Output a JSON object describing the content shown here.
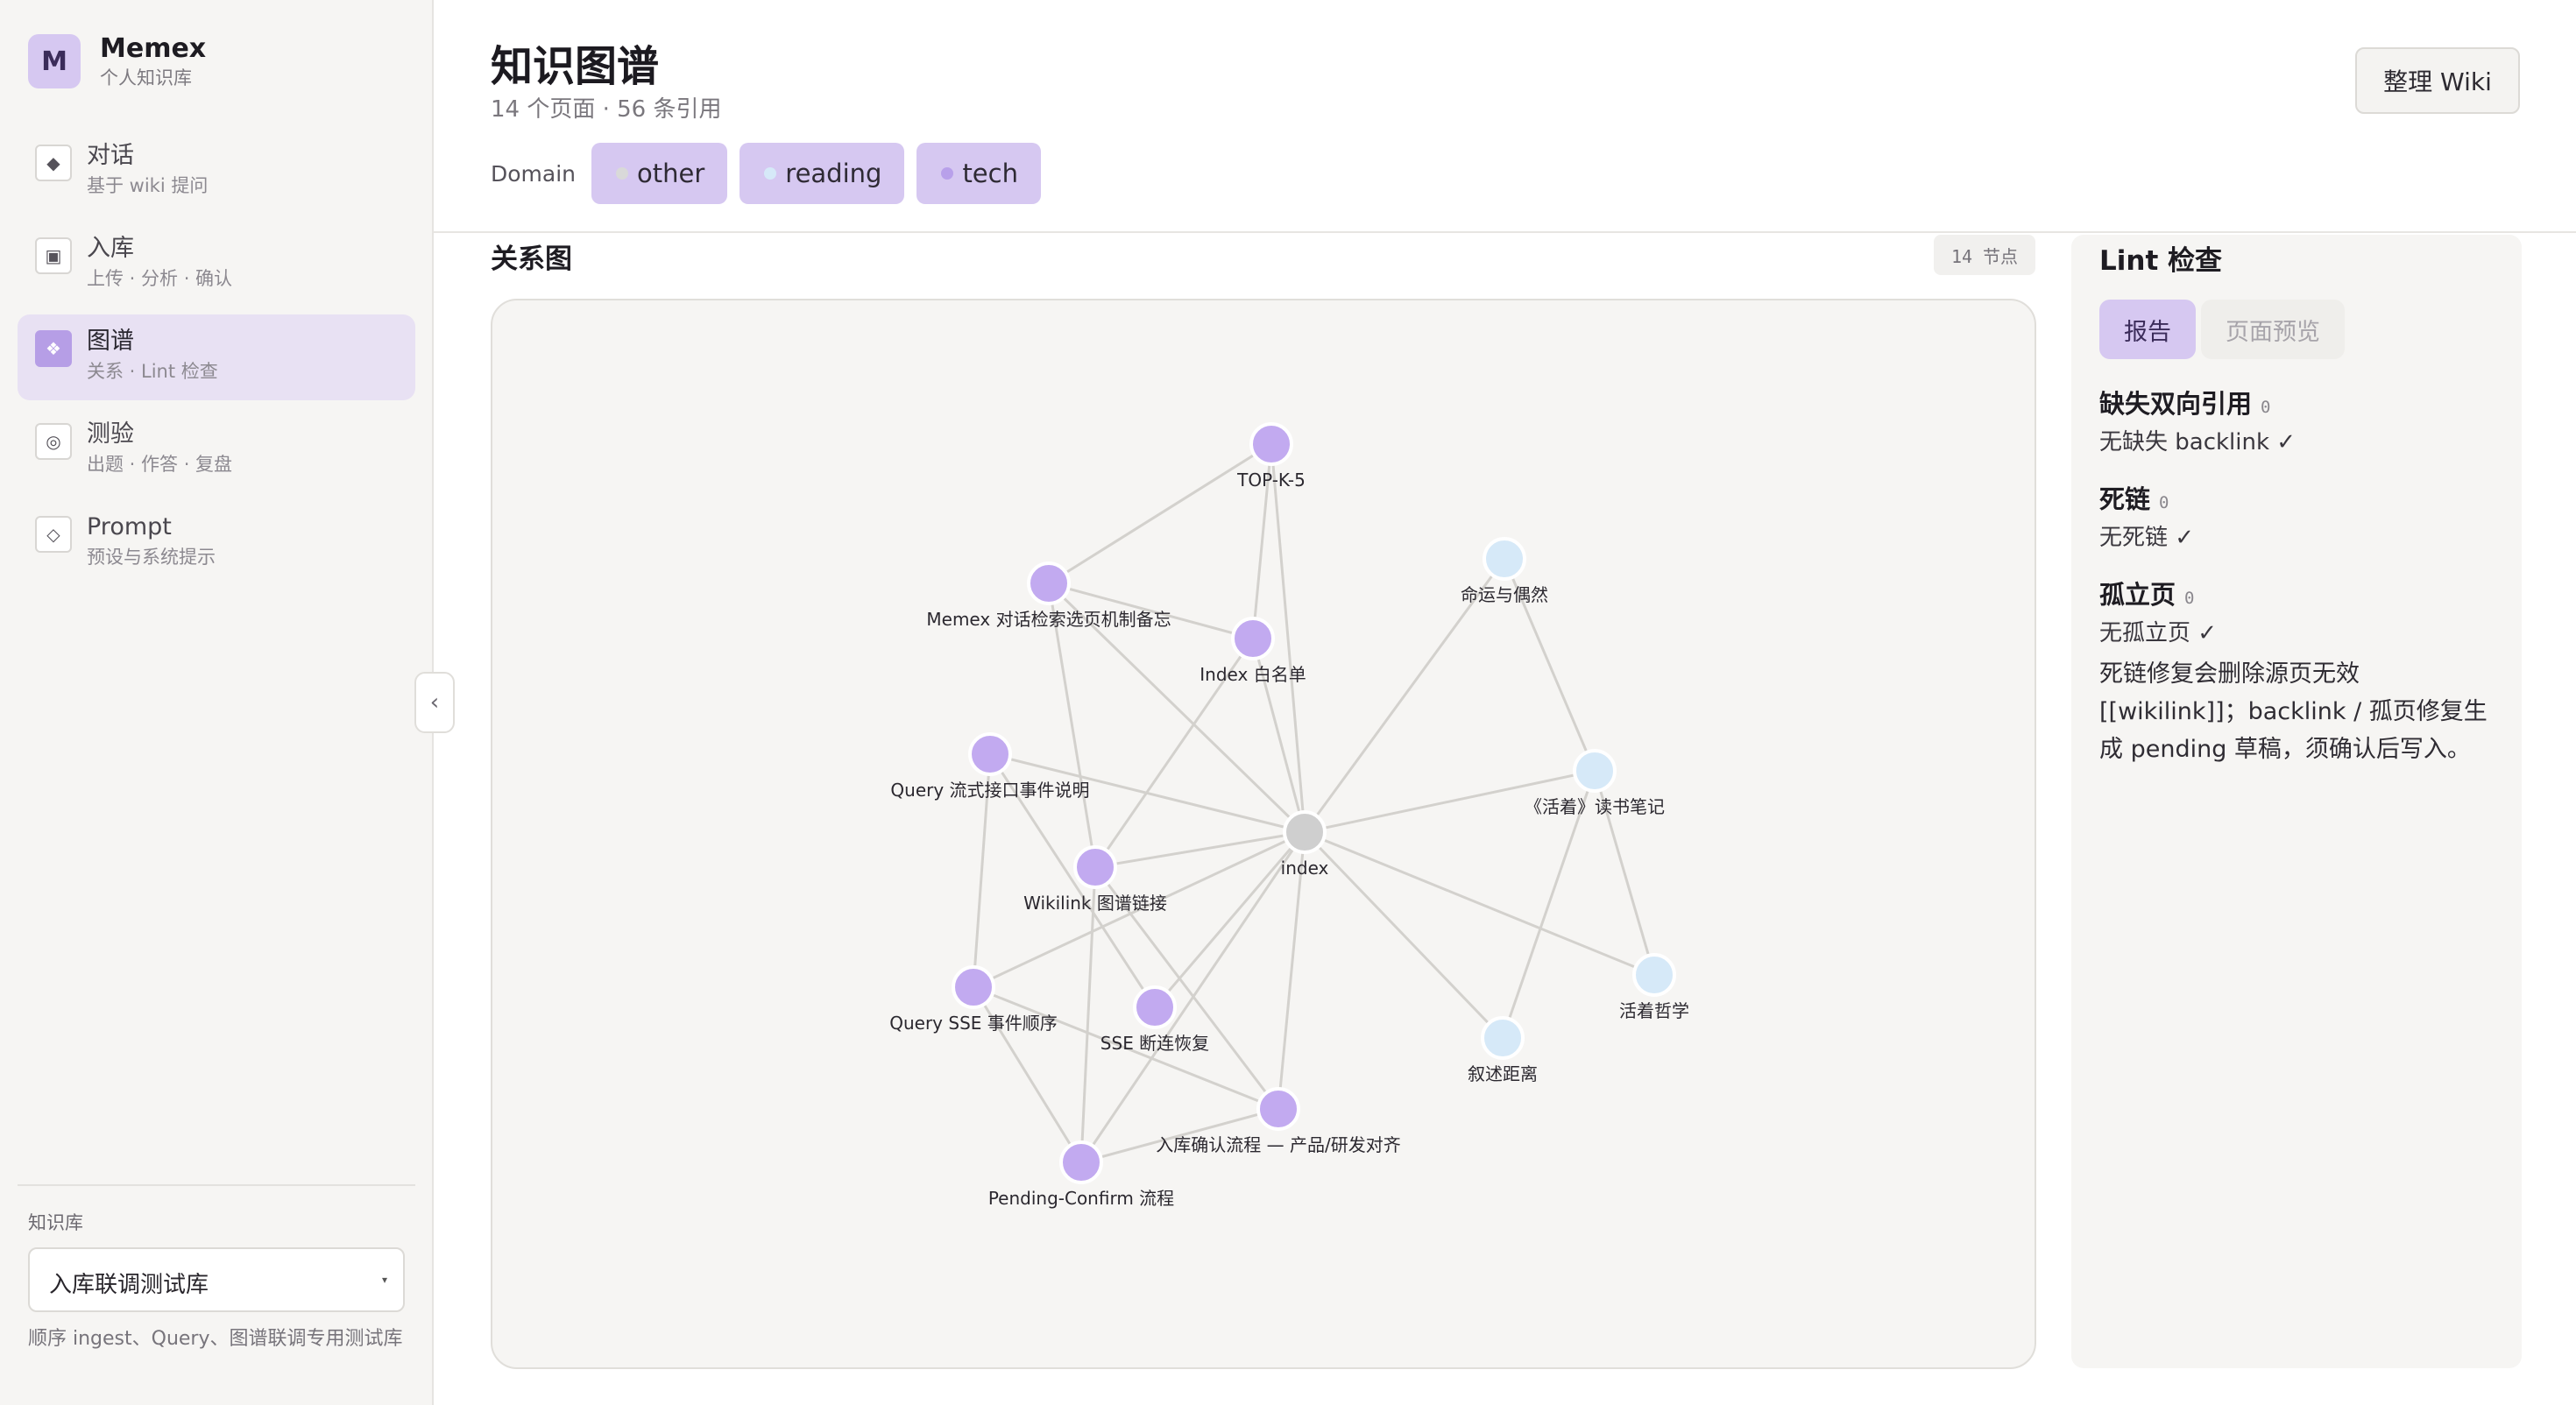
{
  "brand": {
    "avatar": "M",
    "name": "Memex",
    "subtitle": "个人知识库"
  },
  "nav": [
    {
      "icon": "diamond-icon",
      "glyph": "◆",
      "label": "对话",
      "sub": "基于 wiki 提问",
      "active": false
    },
    {
      "icon": "inbox-icon",
      "glyph": "▣",
      "label": "入库",
      "sub": "上传 · 分析 · 确认",
      "active": false
    },
    {
      "icon": "graph-icon",
      "glyph": "❖",
      "label": "图谱",
      "sub": "关系 · Lint 检查",
      "active": true
    },
    {
      "icon": "target-icon",
      "glyph": "◎",
      "label": "测验",
      "sub": "出题 · 作答 · 复盘",
      "active": false
    },
    {
      "icon": "diamond-outline-icon",
      "glyph": "◇",
      "label": "Prompt",
      "sub": "预设与系统提示",
      "active": false
    }
  ],
  "collapse": {
    "glyph": "‹"
  },
  "knowledge_base": {
    "title": "知识库",
    "selected": "入库联调测试库",
    "caret": "▾",
    "description": "顺序 ingest、Query、图谱联调专用测试库"
  },
  "header": {
    "title": "知识图谱",
    "meta": "14 个页面 · 56 条引用",
    "domain_label": "Domain",
    "domains": [
      {
        "label": "other",
        "color": "#d9d9d9"
      },
      {
        "label": "reading",
        "color": "#d6e9f8"
      },
      {
        "label": "tech",
        "color": "#b8a0ea"
      }
    ],
    "tidy_button": "整理 Wiki"
  },
  "graph": {
    "title": "关系图",
    "count_label": "14 节点",
    "colors": {
      "other": "#cfcfcf",
      "reading": "#d6e9f8",
      "tech": "#c2aaf0",
      "edge": "#d3d1cd"
    },
    "nodes": [
      {
        "id": "index",
        "label": "index",
        "domain": "other"
      },
      {
        "id": "topk",
        "label": "TOP-K-5",
        "domain": "tech"
      },
      {
        "id": "memex",
        "label": "Memex 对话检索选页机制备忘",
        "domain": "tech"
      },
      {
        "id": "whitelist",
        "label": "Index 白名单",
        "domain": "tech"
      },
      {
        "id": "qstream",
        "label": "Query 流式接口事件说明",
        "domain": "tech"
      },
      {
        "id": "wikilink",
        "label": "Wikilink 图谱链接",
        "domain": "tech"
      },
      {
        "id": "qsse",
        "label": "Query SSE 事件顺序",
        "domain": "tech"
      },
      {
        "id": "sse",
        "label": "SSE 断连恢复",
        "domain": "tech"
      },
      {
        "id": "ingest",
        "label": "入库确认流程 — 产品/研发对齐",
        "domain": "tech"
      },
      {
        "id": "pending",
        "label": "Pending-Confirm 流程",
        "domain": "tech"
      },
      {
        "id": "fate",
        "label": "命运与偶然",
        "domain": "reading"
      },
      {
        "id": "huozhe",
        "label": "《活着》读书笔记",
        "domain": "reading"
      },
      {
        "id": "philo",
        "label": "活着哲学",
        "domain": "reading"
      },
      {
        "id": "narr",
        "label": "叙述距离",
        "domain": "reading"
      }
    ],
    "edges": [
      [
        "topk",
        "memex"
      ],
      [
        "topk",
        "whitelist"
      ],
      [
        "topk",
        "index"
      ],
      [
        "memex",
        "whitelist"
      ],
      [
        "memex",
        "index"
      ],
      [
        "memex",
        "wikilink"
      ],
      [
        "whitelist",
        "index"
      ],
      [
        "whitelist",
        "wikilink"
      ],
      [
        "qstream",
        "index"
      ],
      [
        "qstream",
        "qsse"
      ],
      [
        "qstream",
        "sse"
      ],
      [
        "wikilink",
        "index"
      ],
      [
        "wikilink",
        "pending"
      ],
      [
        "wikilink",
        "ingest"
      ],
      [
        "qsse",
        "index"
      ],
      [
        "qsse",
        "ingest"
      ],
      [
        "qsse",
        "pending"
      ],
      [
        "sse",
        "index"
      ],
      [
        "pending",
        "index"
      ],
      [
        "pending",
        "ingest"
      ],
      [
        "ingest",
        "index"
      ],
      [
        "fate",
        "index"
      ],
      [
        "fate",
        "huozhe"
      ],
      [
        "huozhe",
        "index"
      ],
      [
        "huozhe",
        "philo"
      ],
      [
        "huozhe",
        "narr"
      ],
      [
        "philo",
        "index"
      ],
      [
        "narr",
        "index"
      ]
    ]
  },
  "lint": {
    "title": "Lint 检查",
    "tabs": [
      {
        "label": "报告",
        "active": true
      },
      {
        "label": "页面预览",
        "active": false
      }
    ],
    "checks": [
      {
        "title": "缺失双向引用",
        "count": "0",
        "result": "无缺失 backlink ✓"
      },
      {
        "title": "死链",
        "count": "0",
        "result": "无死链 ✓"
      },
      {
        "title": "孤立页",
        "count": "0",
        "result": "无孤立页 ✓"
      }
    ],
    "note": "死链修复会删除源页无效 [[wikilink]]；backlink / 孤页修复生成 pending 草稿，须确认后写入。"
  }
}
